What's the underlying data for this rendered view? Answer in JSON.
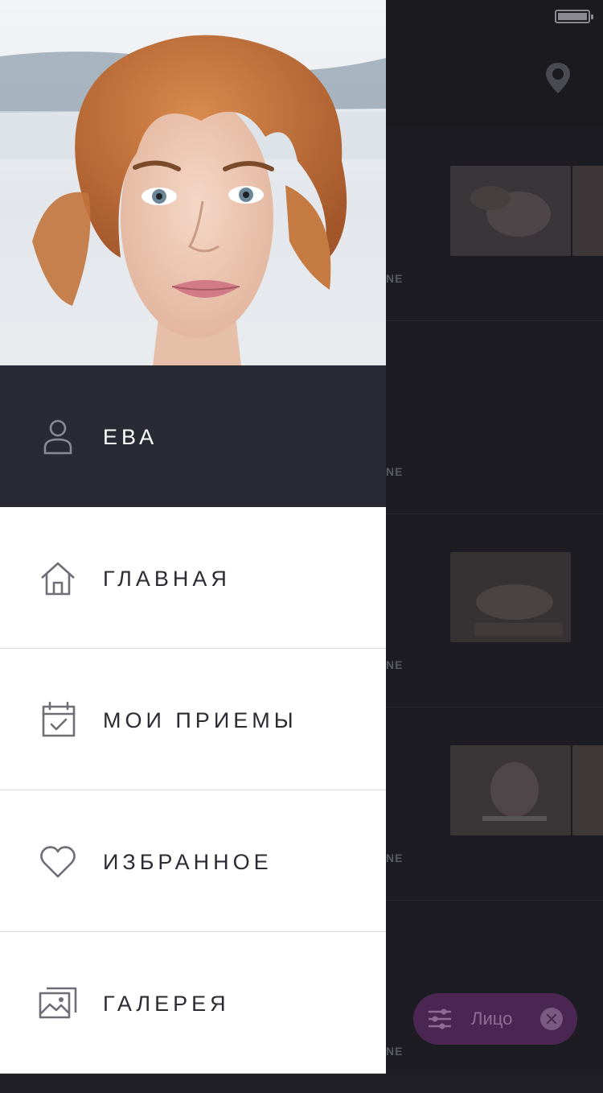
{
  "drawer": {
    "user": {
      "name": "ЕВА",
      "icon": "user-icon"
    },
    "menu": [
      {
        "label": "ГЛАВНАЯ",
        "icon": "home-icon"
      },
      {
        "label": "МОИ ПРИЕМЫ",
        "icon": "calendar-check-icon"
      },
      {
        "label": "ИЗБРАННОЕ",
        "icon": "heart-icon"
      },
      {
        "label": "ГАЛЕРЕЯ",
        "icon": "gallery-icon"
      }
    ]
  },
  "background": {
    "row_tags": [
      "NE",
      "NE",
      "NE",
      "NE",
      "NE"
    ],
    "filter_chip": {
      "label": "Лицо"
    }
  },
  "colors": {
    "drawer_bg": "#ffffff",
    "user_row_bg": "#2a2a34",
    "app_bg": "#1c1c22",
    "chip_bg": "#4b2652"
  }
}
